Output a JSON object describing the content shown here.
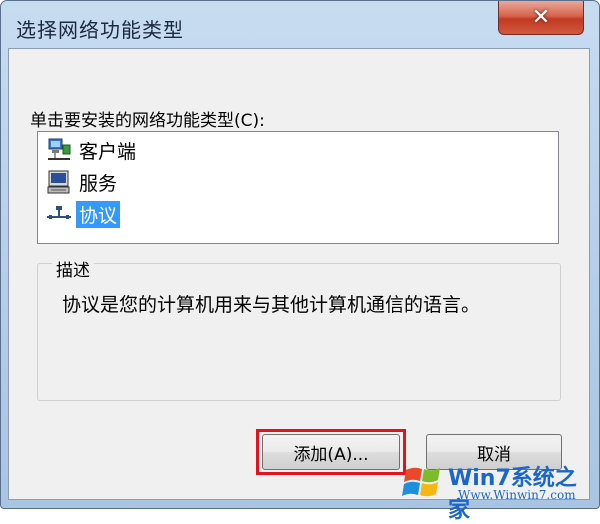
{
  "window": {
    "title": "选择网络功能类型",
    "close_glyph": "✕"
  },
  "prompt": "单击要安装的网络功能类型(C):",
  "list": {
    "items": [
      {
        "label": "客户端",
        "icon": "client-network-icon",
        "selected": false
      },
      {
        "label": "服务",
        "icon": "service-computer-icon",
        "selected": false
      },
      {
        "label": "协议",
        "icon": "protocol-network-icon",
        "selected": true
      }
    ]
  },
  "description": {
    "group_title": "描述",
    "text": "协议是您的计算机用来与其他计算机通信的语言。"
  },
  "buttons": {
    "add": "添加(A)...",
    "cancel": "取消"
  },
  "watermark": {
    "brand": "Win7系统之家",
    "url": "Www.Winwin7.com"
  },
  "colors": {
    "selection": "#3399ff",
    "focus_ring": "#e0141e",
    "close_button": "#c23a22"
  }
}
